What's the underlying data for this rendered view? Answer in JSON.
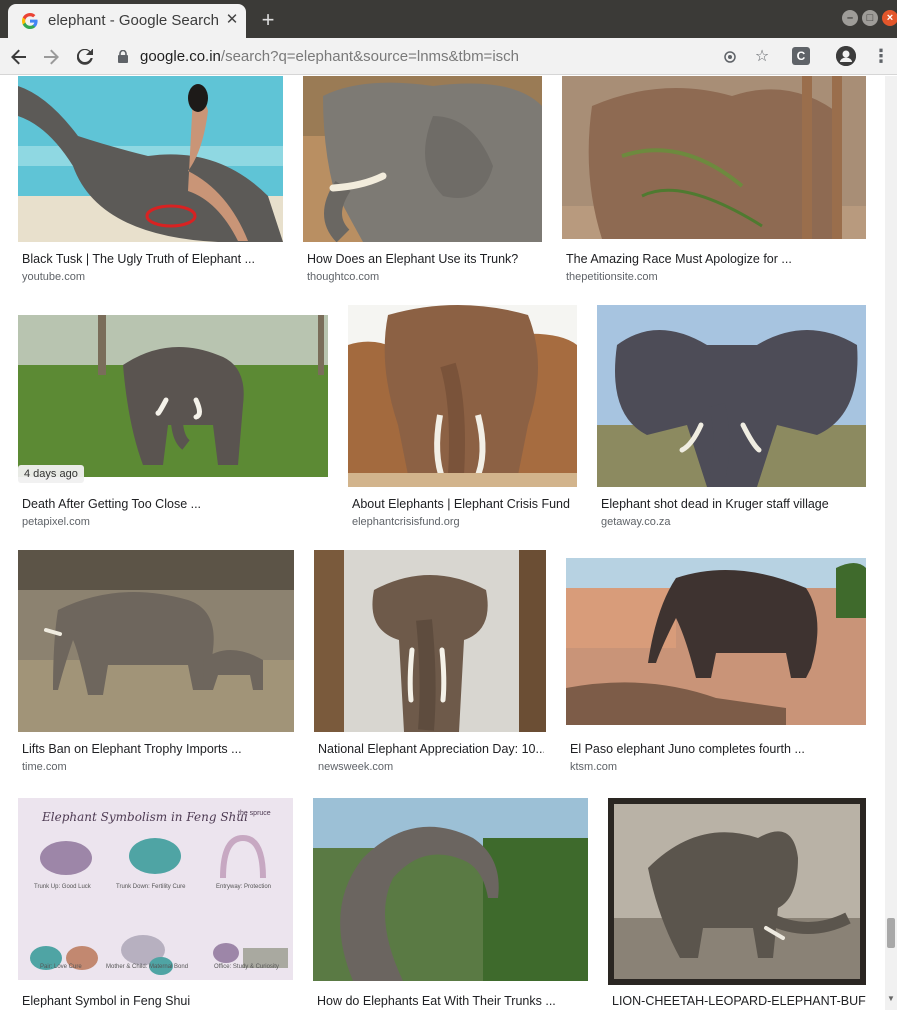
{
  "browser": {
    "tab_title": "elephant - Google Search",
    "tab_close": "✕",
    "new_tab": "+",
    "url_host": "google.co.in",
    "url_rest": "/search?q=elephant&source=lnms&tbm=isch",
    "ext_label": "C"
  },
  "results": [
    {
      "caption": "Black Tusk | The Ugly Truth of Elephant ...",
      "source": "youtube.com"
    },
    {
      "caption": "How Does an Elephant Use its Trunk?",
      "source": "thoughtco.com"
    },
    {
      "caption": "The Amazing Race Must Apologize for ...",
      "source": "thepetitionsite.com"
    },
    {
      "caption": "Death After Getting Too Close ...",
      "source": "petapixel.com",
      "badge": "4 days ago"
    },
    {
      "caption": "About Elephants | Elephant Crisis Fund",
      "source": "elephantcrisisfund.org"
    },
    {
      "caption": "Elephant shot dead in Kruger staff village",
      "source": "getaway.co.za"
    },
    {
      "caption": "Lifts Ban on Elephant Trophy Imports ...",
      "source": "time.com"
    },
    {
      "caption": "National Elephant Appreciation Day: 10...",
      "source": "newsweek.com"
    },
    {
      "caption": "El Paso elephant Juno completes fourth ...",
      "source": "ktsm.com"
    },
    {
      "caption": "Elephant Symbol in Feng Shui",
      "source": ""
    },
    {
      "caption": "How do Elephants Eat With Their Trunks ...",
      "source": ""
    },
    {
      "caption": "LION-CHEETAH-LEOPARD-ELEPHANT-BUFF...",
      "source": ""
    }
  ],
  "feng_shui": {
    "title": "Elephant Symbolism in Feng Shui",
    "brand": "the spruce",
    "labels": [
      "Trunk Up: Good Luck",
      "Trunk Down: Fertility Cure",
      "Entryway: Protection",
      "Pair: Love Cure",
      "Mother & Child: Maternal Bond",
      "Office: Study & Curiosity"
    ]
  },
  "colors": {
    "tabstrip": "#3b3a37",
    "toolbar": "#f2f2f2",
    "close_button": "#e3562b",
    "caption": "#202124",
    "source": "#5f6368"
  }
}
